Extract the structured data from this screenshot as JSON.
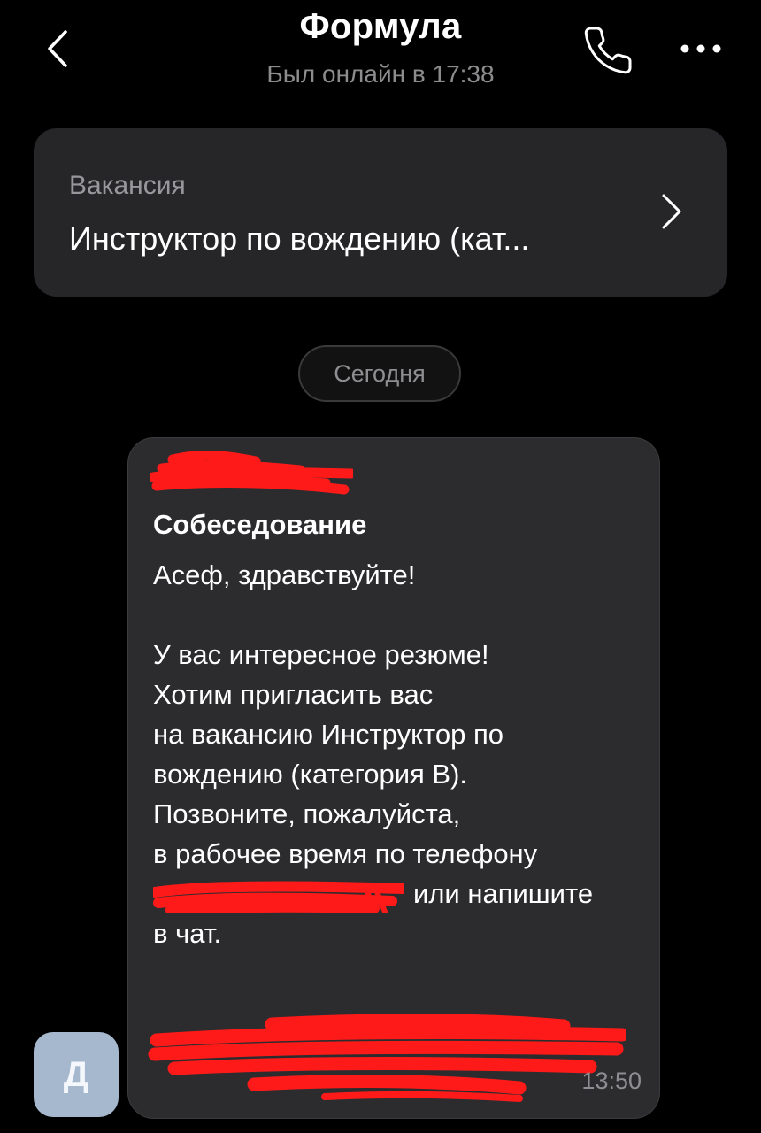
{
  "header": {
    "title": "Формула",
    "status": "Был онлайн в 17:38"
  },
  "vacancy": {
    "label": "Вакансия",
    "name": "Инструктор по вождению (кат..."
  },
  "date_divider": "Сегодня",
  "message": {
    "title": "Собеседование",
    "lines": [
      "Асеф, здравствуйте!",
      "",
      "У вас интересное резюме!",
      "Хотим пригласить вас",
      "на вакансию Инструктор по",
      "вождению (категория В).",
      "Позвоните, пожалуйста,",
      "в рабочее время по телефону"
    ],
    "after_phone": "или напишите",
    "last_line": "в чат.",
    "time": "13:50"
  },
  "avatar": {
    "initial": "Д"
  },
  "colors": {
    "background": "#000000",
    "card": "#262628",
    "bubble": "#2c2c2e",
    "muted_text": "#8e8e92",
    "avatar": "#a6b8ce",
    "redaction": "#ff1a1a"
  }
}
